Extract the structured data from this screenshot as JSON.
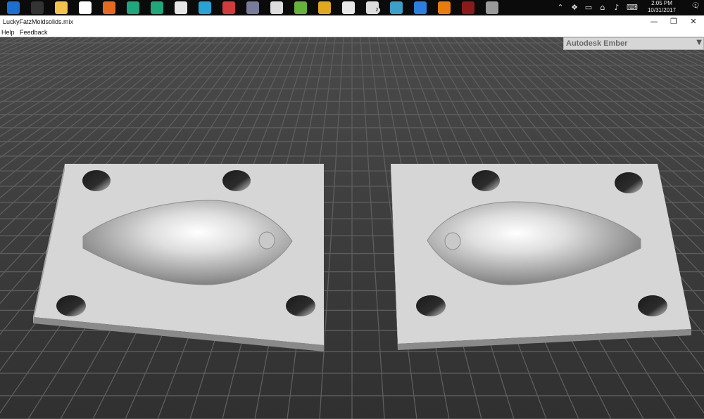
{
  "taskbar": {
    "apps": [
      {
        "icon": "edge-icon",
        "color": "#1a6fd1"
      },
      {
        "icon": "amazon-icon",
        "color": "#333333"
      },
      {
        "icon": "file-explorer-icon",
        "color": "#f2c24b"
      },
      {
        "icon": "store-icon",
        "color": "#ffffff"
      },
      {
        "icon": "firefox-icon",
        "color": "#e66a1e"
      },
      {
        "icon": "c-app-icon",
        "color": "#1fa67a"
      },
      {
        "icon": "c-app-2-icon",
        "color": "#1fa67a"
      },
      {
        "icon": "printer-icon",
        "color": "#e6e6e6"
      },
      {
        "icon": "triangle-app-icon",
        "color": "#27a3d6"
      },
      {
        "icon": "red-app-icon",
        "color": "#d23b3b"
      },
      {
        "icon": "meshmixer-icon",
        "color": "#7a7a9a"
      },
      {
        "icon": "calculator-icon",
        "color": "#dddddd"
      },
      {
        "icon": "green-app-icon",
        "color": "#66b23a"
      },
      {
        "icon": "yellow-app-icon",
        "color": "#e0a81a"
      },
      {
        "icon": "f-app-icon",
        "color": "#e8e8e8"
      },
      {
        "icon": "mail-icon",
        "color": "#dddddd"
      },
      {
        "icon": "s-app-icon",
        "color": "#3aa0c8"
      },
      {
        "icon": "dropbox-icon",
        "color": "#2b7fe0"
      },
      {
        "icon": "blender-icon",
        "color": "#e87d0d"
      },
      {
        "icon": "dark-red-app-icon",
        "color": "#8a1a1a"
      },
      {
        "icon": "gray-app-icon",
        "color": "#9a9a9a"
      }
    ],
    "time": "2:05 PM",
    "date": "10/31/2017",
    "mail_badge": "2",
    "notification_badge": "1"
  },
  "window": {
    "title": "LuckyFatzMoldsolids.mix",
    "minimize": "—",
    "maximize": "❐",
    "close": "✕"
  },
  "menu": {
    "items": [
      "Help",
      "Feedback"
    ]
  },
  "panel": {
    "title": "Autodesk Ember",
    "arrow": "▼"
  }
}
